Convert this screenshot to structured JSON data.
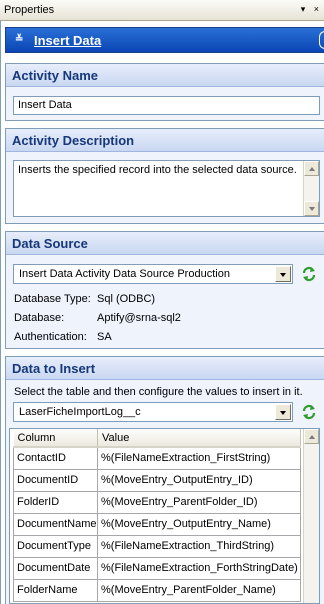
{
  "window": {
    "title": "Properties",
    "controls": "▾ ×"
  },
  "header": {
    "title": "Insert Data"
  },
  "activity_name": {
    "caption": "Activity Name",
    "value": "Insert Data"
  },
  "activity_description": {
    "caption": "Activity Description",
    "value": "Inserts the specified record into the selected data source."
  },
  "data_source": {
    "caption": "Data Source",
    "selected": "Insert Data Activity Data Source Production",
    "rows": [
      {
        "label": "Database Type:",
        "value": "Sql (ODBC)"
      },
      {
        "label": "Database:",
        "value": "Aptify@srna-sql2"
      },
      {
        "label": "Authentication:",
        "value": "SA"
      }
    ]
  },
  "data_to_insert": {
    "caption": "Data to Insert",
    "instruction": "Select the table and then configure the values to insert in it.",
    "table_selected": "LaserFicheImportLog__c",
    "columns": [
      "Column",
      "Value"
    ],
    "rows": [
      {
        "column": "ContactID",
        "value": "%(FileNameExtraction_FirstString)"
      },
      {
        "column": "DocumentID",
        "value": "%(MoveEntry_OutputEntry_ID)"
      },
      {
        "column": "FolderID",
        "value": "%(MoveEntry_ParentFolder_ID)"
      },
      {
        "column": "DocumentName",
        "value": "%(MoveEntry_OutputEntry_Name)"
      },
      {
        "column": "DocumentType",
        "value": "%(FileNameExtraction_ThirdString)"
      },
      {
        "column": "DocumentDate",
        "value": "%(FileNameExtraction_ForthStringDate)"
      },
      {
        "column": "FolderName",
        "value": "%(MoveEntry_ParentFolder_Name)"
      }
    ]
  },
  "colors": {
    "header_blue": "#0a46b4",
    "caption_text": "#16387a",
    "refresh_green": "#2e9b2e"
  }
}
